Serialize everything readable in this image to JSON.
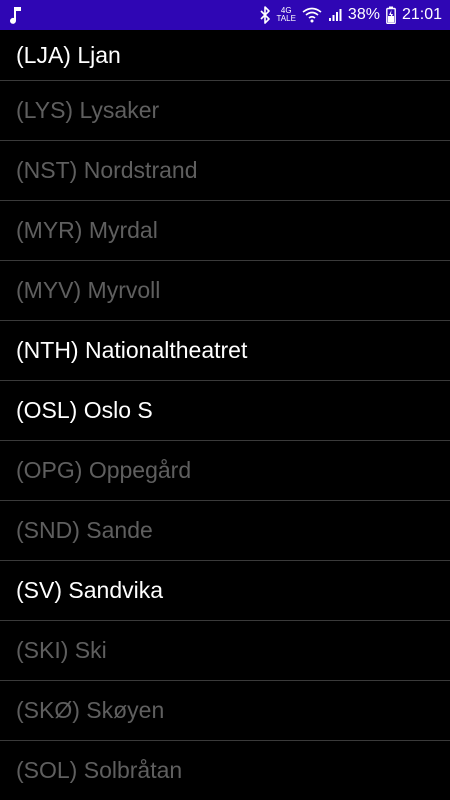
{
  "status_bar": {
    "background": "#2f06b4",
    "left_icon": "music-note-icon",
    "network_top": "4G",
    "network_bottom": "TALE",
    "battery_percent": "38%",
    "time": "21:01"
  },
  "stations": [
    {
      "label": "(LJA) Ljan",
      "enabled": true
    },
    {
      "label": "(LYS) Lysaker",
      "enabled": false
    },
    {
      "label": "(NST) Nordstrand",
      "enabled": false
    },
    {
      "label": "(MYR) Myrdal",
      "enabled": false
    },
    {
      "label": "(MYV) Myrvoll",
      "enabled": false
    },
    {
      "label": "(NTH) Nationaltheatret",
      "enabled": true
    },
    {
      "label": "(OSL) Oslo S",
      "enabled": true
    },
    {
      "label": "(OPG) Oppegård",
      "enabled": false
    },
    {
      "label": "(SND) Sande",
      "enabled": false
    },
    {
      "label": "(SV) Sandvika",
      "enabled": true
    },
    {
      "label": "(SKI) Ski",
      "enabled": false
    },
    {
      "label": "(SKØ) Skøyen",
      "enabled": false
    },
    {
      "label": "(SOL) Solbråtan",
      "enabled": false
    }
  ],
  "colors": {
    "enabled_text": "#ffffff",
    "disabled_text": "#5f5f5f",
    "divider": "#3a3a3a"
  }
}
